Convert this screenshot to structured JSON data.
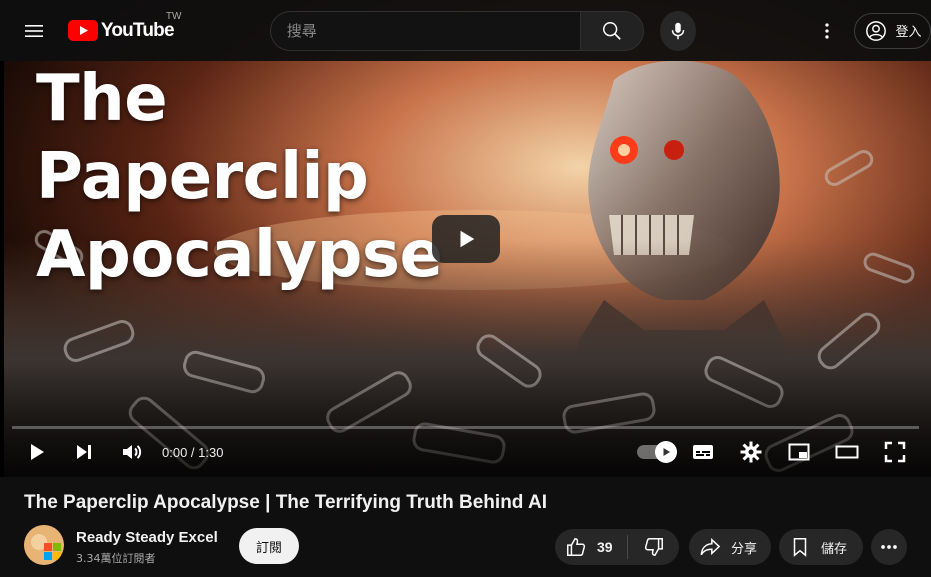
{
  "masthead": {
    "logo_text": "YouTube",
    "country_code": "TW",
    "search_placeholder": "搜尋",
    "signin_label": "登入"
  },
  "player": {
    "thumbnail_text": "The\nPaperclip\nApocalypse",
    "time_display": "0:00 / 1:30",
    "progress_fraction": 0
  },
  "video": {
    "title": "The Paperclip Apocalypse | The Terrifying Truth Behind AI"
  },
  "channel": {
    "name": "Ready Steady Excel",
    "subscribers": "3.34萬位訂閱者",
    "subscribe_label": "訂閱"
  },
  "actions": {
    "like_count": "39",
    "share_label": "分享",
    "save_label": "儲存"
  },
  "colors": {
    "brand_red": "#ff0000",
    "background": "#0f0f0f",
    "pill": "#272727"
  }
}
